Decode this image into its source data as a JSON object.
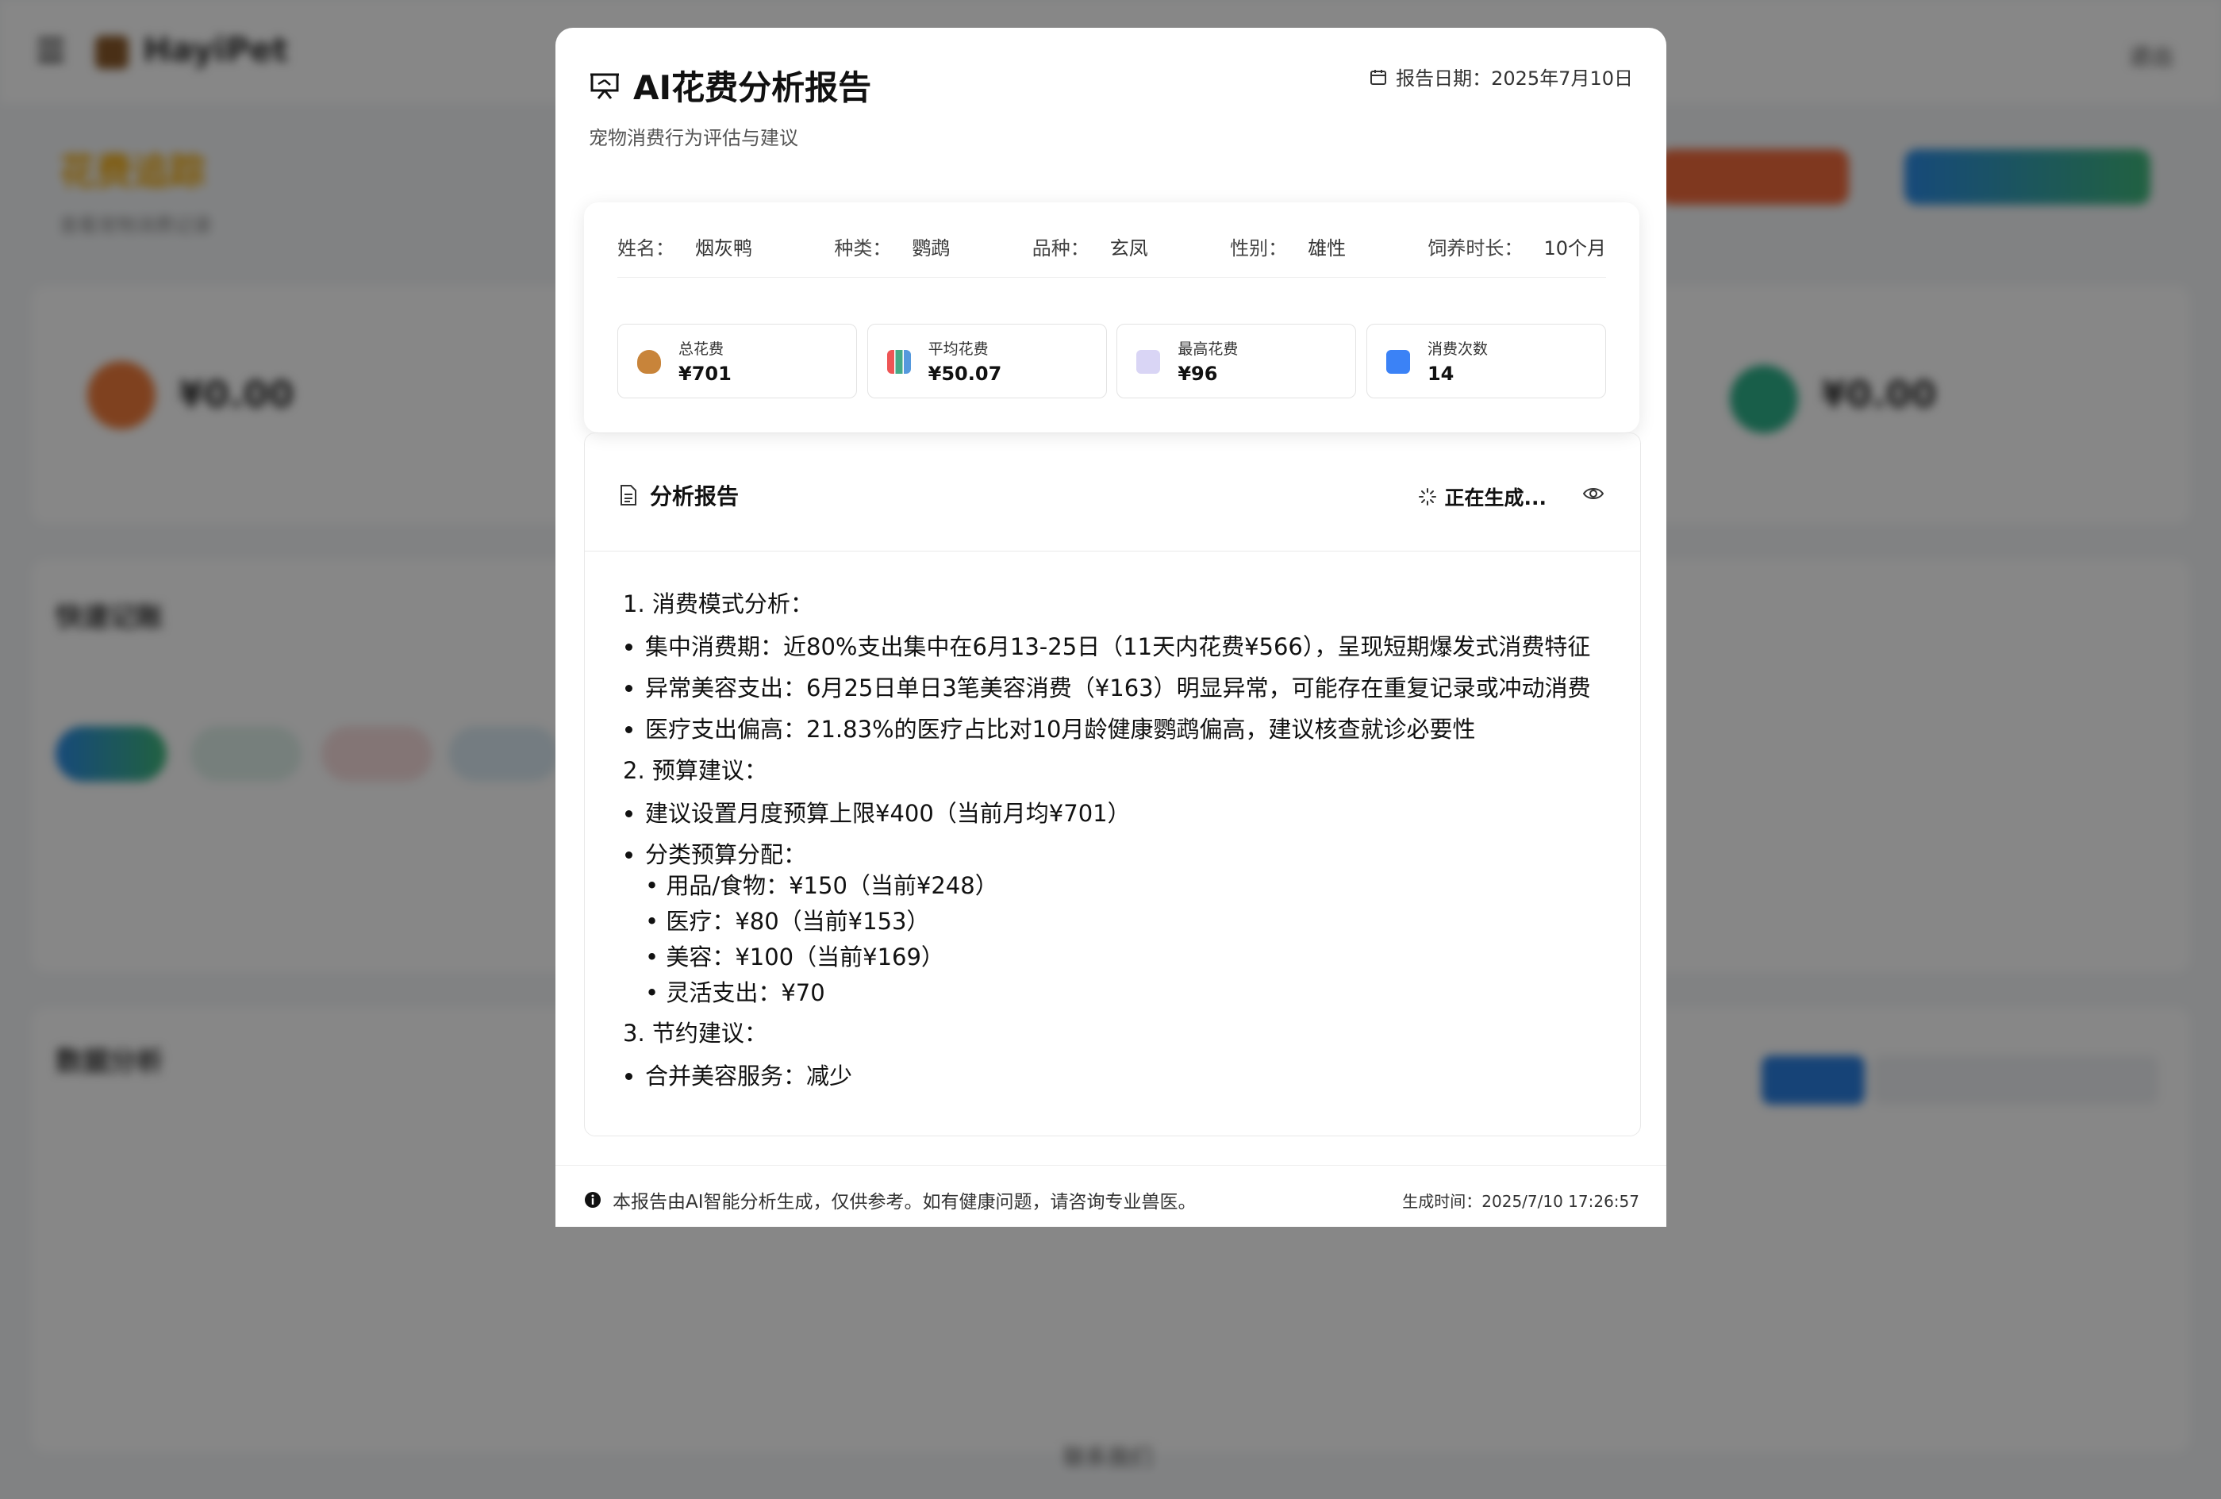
{
  "background": {
    "app_name": "HayiPet",
    "logout": "退出",
    "page_title": "花费追踪",
    "page_subtitle": "查看宠物消费记录",
    "total_value": "¥0.00",
    "right_value": "¥0.00",
    "quick_title": "快速记账",
    "analysis_title": "数据分析",
    "footer": "联系我们"
  },
  "modal": {
    "title": "AI花费分析报告",
    "subtitle": "宠物消费行为评估与建议",
    "date_label": "报告日期：",
    "date_value": "2025年7月10日",
    "pet_info": [
      {
        "label": "姓名：",
        "value": "烟灰鸭"
      },
      {
        "label": "种类：",
        "value": "鹦鹉"
      },
      {
        "label": "品种：",
        "value": "玄凤"
      },
      {
        "label": "性别：",
        "value": "雄性"
      },
      {
        "label": "饲养时长：",
        "value": "10个月"
      }
    ],
    "stats": [
      {
        "label": "总花费",
        "value": "¥701",
        "icon": "money-bag-icon",
        "color": "#c8843a"
      },
      {
        "label": "平均花费",
        "value": "¥50.07",
        "icon": "bar-chart-icon",
        "color": "#6a8fd8"
      },
      {
        "label": "最高花费",
        "value": "¥96",
        "icon": "trend-chart-icon",
        "color": "#8a84d6"
      },
      {
        "label": "消费次数",
        "value": "14",
        "icon": "number-icon",
        "color": "#3b82f6"
      }
    ],
    "report": {
      "title": "分析报告",
      "status": "正在生成...",
      "sec1": "1. 消费模式分析：",
      "sec1_items": [
        "集中消费期：近80%支出集中在6月13-25日（11天内花费¥566），呈现短期爆发式消费特征",
        "异常美容支出：6月25日单日3笔美容消费（¥163）明显异常，可能存在重复记录或冲动消费",
        "医疗支出偏高：21.83%的医疗占比对10月龄健康鹦鹉偏高，建议核查就诊必要性"
      ],
      "sec2": "2. 预算建议：",
      "sec2_item1": "建议设置月度预算上限¥400（当前月均¥701）",
      "sec2_item2": "分类预算分配：",
      "sec2_subs": [
        "• 用品/食物：¥150（当前¥248）",
        "• 医疗：¥80（当前¥153）",
        "• 美容：¥100（当前¥169）",
        "• 灵活支出：¥70"
      ],
      "sec3": "3. 节约建议：",
      "sec3_item1": "合并美容服务：减少"
    },
    "footer_note": "本报告由AI智能分析生成，仅供参考。如有健康问题，请咨询专业兽医。",
    "generated_label": "生成时间：",
    "generated_value": "2025/7/10 17:26:57"
  }
}
